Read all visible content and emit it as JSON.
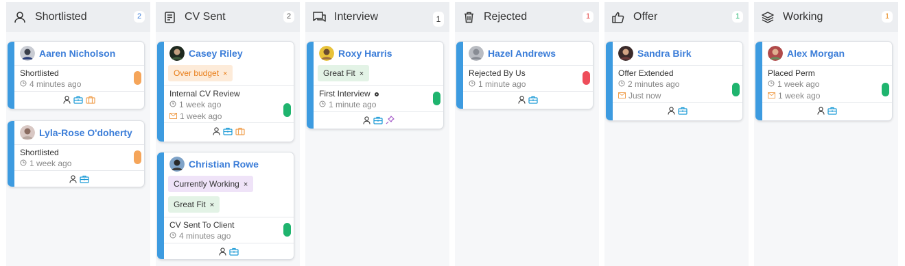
{
  "columns": [
    {
      "title": "Shortlisted",
      "count": "2",
      "icon": "user-icon",
      "count_color": "#3b7dd8"
    },
    {
      "title": "CV Sent",
      "count": "2",
      "icon": "document-icon",
      "count_color": "#555555"
    },
    {
      "title": "Interview",
      "count": "1",
      "icon": "chat-icon",
      "count_color": "#333333"
    },
    {
      "title": "Rejected",
      "count": "1",
      "icon": "trash-icon",
      "count_color": "#e03c3c"
    },
    {
      "title": "Offer",
      "count": "1",
      "icon": "thumbs-up-icon",
      "count_color": "#1fb46e"
    },
    {
      "title": "Working",
      "count": "1",
      "icon": "layers-icon",
      "count_color": "#e8891a"
    }
  ],
  "cards": {
    "aaren": {
      "name": "Aaren Nicholson",
      "status": "Shortlisted",
      "time": "4 minutes ago"
    },
    "lyla": {
      "name": "Lyla-Rose O'doherty",
      "status": "Shortlisted",
      "time": "1 week ago"
    },
    "casey": {
      "name": "Casey Riley",
      "tag1": "Over budget",
      "status": "Internal CV Review",
      "time": "1 week ago",
      "mail_time": "1 week ago"
    },
    "christian": {
      "name": "Christian Rowe",
      "tag1": "Currently Working",
      "tag2": "Great Fit",
      "status": "CV Sent To Client",
      "time": "4 minutes ago"
    },
    "roxy": {
      "name": "Roxy Harris",
      "tag1": "Great Fit",
      "status": "First Interview",
      "time": "1 minute ago"
    },
    "hazel": {
      "name": "Hazel Andrews",
      "status": "Rejected By Us",
      "time": "1 minute ago"
    },
    "sandra": {
      "name": "Sandra Birk",
      "status": "Offer Extended",
      "time": "2 minutes ago",
      "mail_time": "Just now"
    },
    "alex": {
      "name": "Alex Morgan",
      "status": "Placed Perm",
      "time": "1 week ago",
      "mail_time": "1 week ago"
    }
  },
  "tag_remove_glyph": "×",
  "colors": {
    "accent": "#3d9be0",
    "name_link": "#3b7dd8",
    "pill_orange": "#f5a55a",
    "pill_green": "#1fb46e",
    "pill_red": "#ee4d5a"
  }
}
